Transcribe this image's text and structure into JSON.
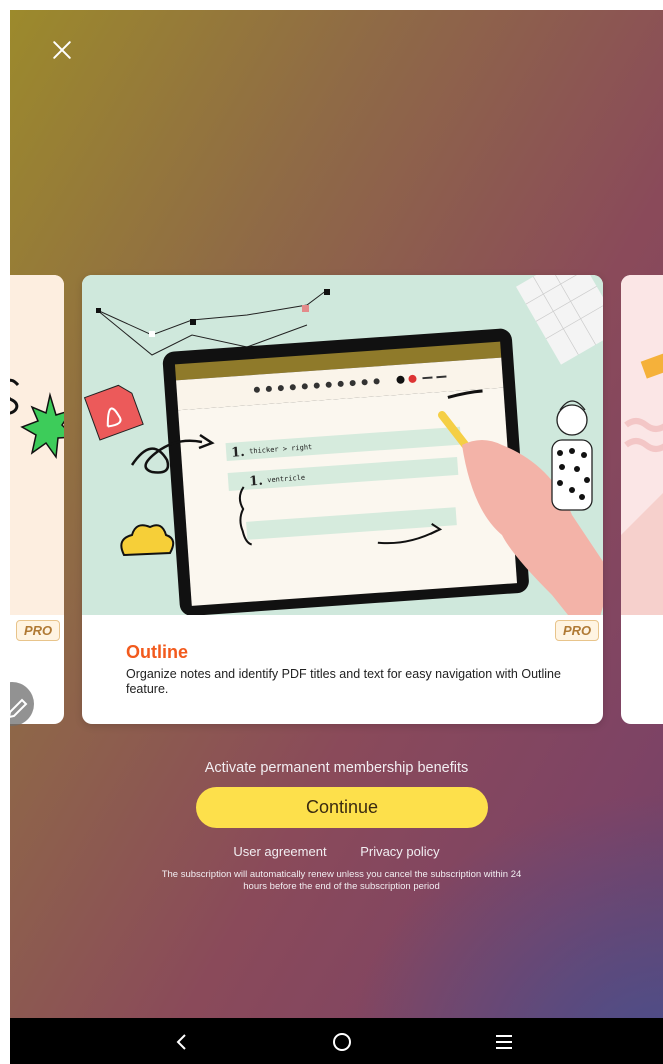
{
  "card": {
    "badge": "PRO",
    "title": "Outline",
    "description": "Organize notes and identify PDF titles and text for easy navigation with Outline feature.",
    "illustration": {
      "note_line_1": "thicker > right",
      "note_line_2": "ventricle",
      "num_1": "1.",
      "num_2": "1."
    }
  },
  "left_card": {
    "badge": "PRO"
  },
  "activate_text": "Activate permanent membership benefits",
  "continue_label": "Continue",
  "links": {
    "user_agreement": "User agreement",
    "privacy_policy": "Privacy policy"
  },
  "subscription_note": "The subscription will automatically renew unless you cancel the subscription within 24 hours before the end of the subscription period",
  "colors": {
    "accent_title": "#f25a1d",
    "continue_button": "#fde04b",
    "pro_badge_text": "#b07a35"
  },
  "icons": {
    "close": "close-icon",
    "back": "back-icon",
    "home": "home-icon",
    "menu": "menu-icon",
    "edit": "pencil-icon"
  }
}
